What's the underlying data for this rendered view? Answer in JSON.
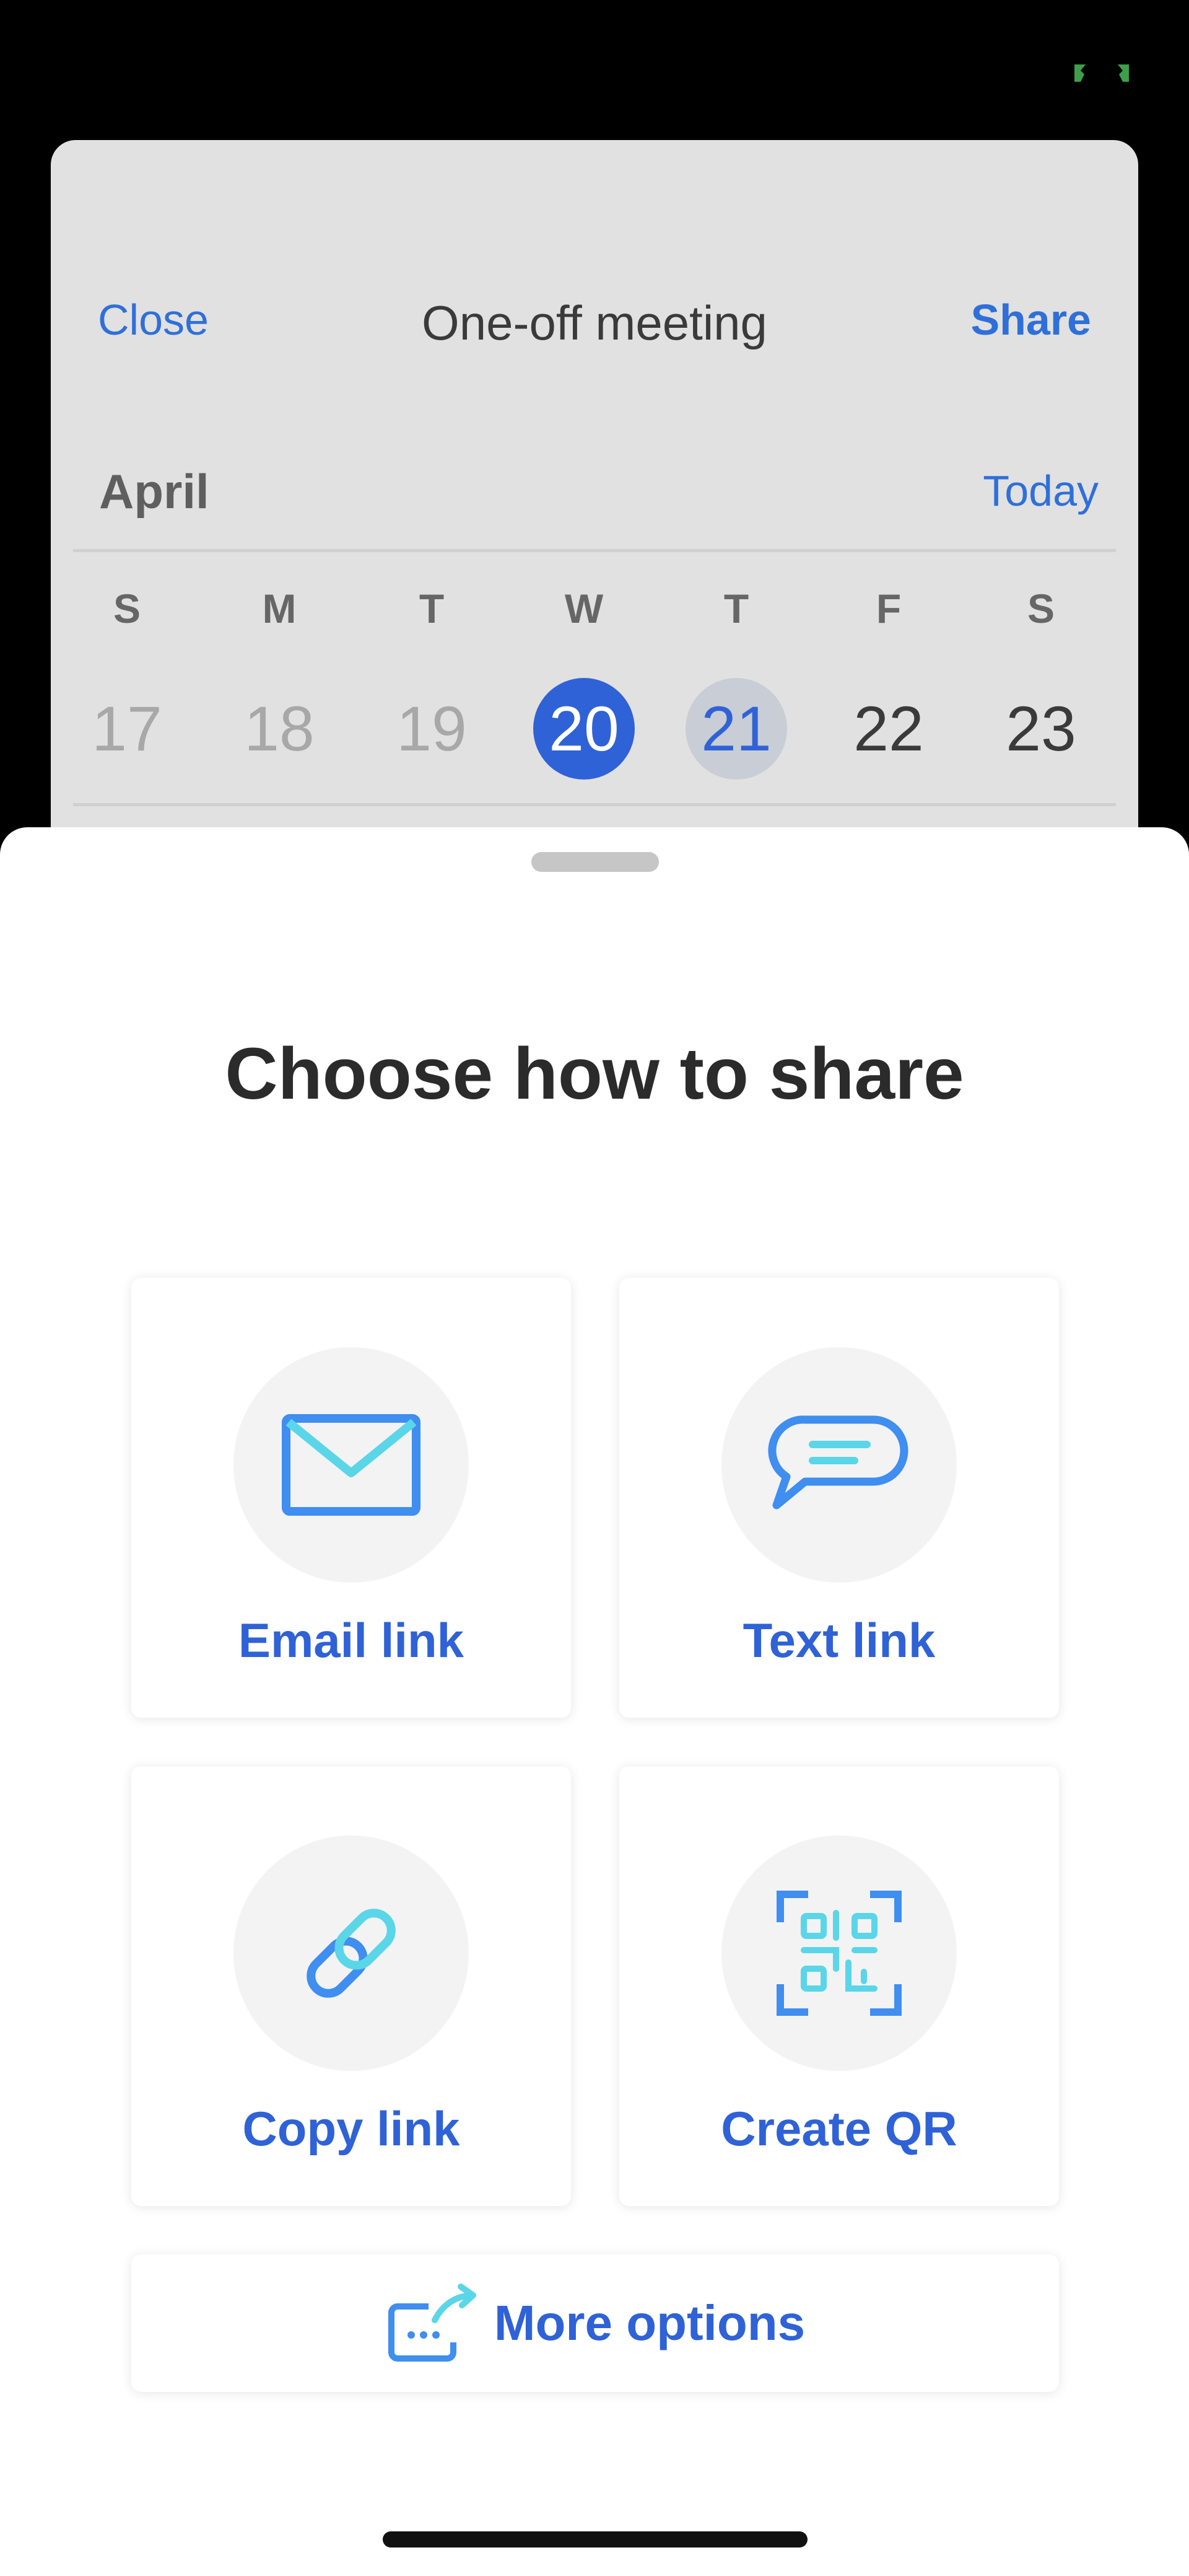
{
  "colors": {
    "accent": "#2f62d6",
    "icon_blue": "#3f8ef0",
    "icon_cyan": "#5ad6e8",
    "selected_date_bg": "#2f62d6",
    "today_date_bg": "#c8cdd6"
  },
  "background_screen": {
    "nav": {
      "close_label": "Close",
      "title": "One-off meeting",
      "share_label": "Share"
    },
    "calendar": {
      "month": "April",
      "today_label": "Today",
      "weekdays": [
        "S",
        "M",
        "T",
        "W",
        "T",
        "F",
        "S"
      ],
      "dates": [
        "17",
        "18",
        "19",
        "20",
        "21",
        "22",
        "23"
      ],
      "selected_date": "20",
      "today_date": "21"
    }
  },
  "share_sheet": {
    "title": "Choose how to share",
    "options": {
      "email": {
        "label": "Email link",
        "icon": "envelope-icon"
      },
      "text": {
        "label": "Text link",
        "icon": "chat-bubble-icon"
      },
      "copy": {
        "label": "Copy link",
        "icon": "link-icon"
      },
      "qr": {
        "label": "Create QR",
        "icon": "qr-code-icon"
      }
    },
    "more_options": {
      "label": "More options",
      "icon": "share-arrow-icon"
    }
  }
}
